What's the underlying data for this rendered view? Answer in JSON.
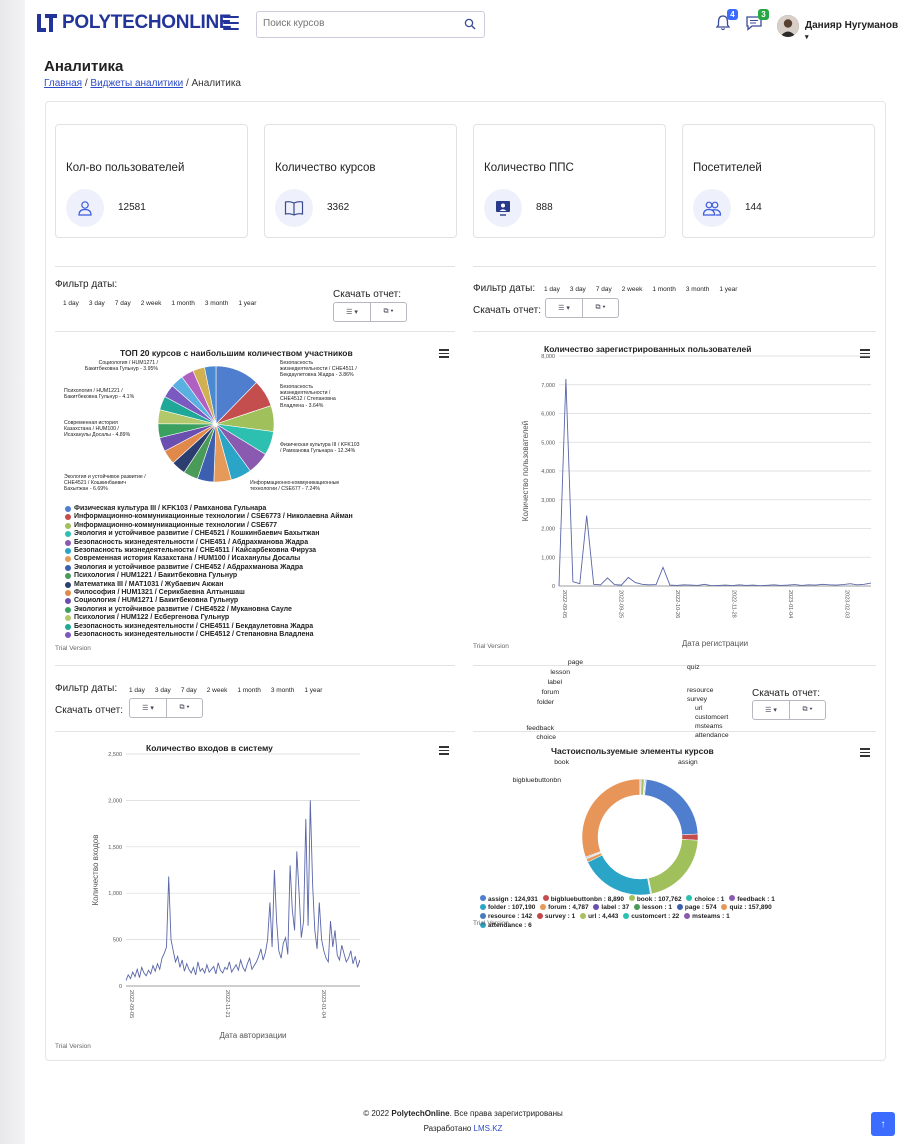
{
  "header": {
    "logo_text": "POLYTECHONLINE",
    "search_placeholder": "Поиск курсов",
    "notifications_count": "4",
    "messages_count": "3",
    "user_name": "Данияр Нугуманов",
    "user_caret": "▾",
    "brand_color": "#22349a"
  },
  "page": {
    "title": "Аналитика",
    "breadcrumb": [
      {
        "label": "Главная"
      },
      {
        "label": "Виджеты аналитики"
      },
      {
        "label": "Аналитика"
      }
    ],
    "breadcrumb_sep": "/"
  },
  "stats": [
    {
      "title": "Кол-во пользователей",
      "value": "12581",
      "icon": "user-icon"
    },
    {
      "title": "Количество курсов",
      "value": "3362",
      "icon": "book-icon"
    },
    {
      "title": "Количество ППС",
      "value": "888",
      "icon": "teacher-icon"
    },
    {
      "title": "Посетителей",
      "value": "144",
      "icon": "users-icon"
    }
  ],
  "filters": {
    "label": "Фильтр даты:",
    "options": [
      "1 day",
      "3 day",
      "7 day",
      "2 week",
      "1 month",
      "3 month",
      "1 year"
    ],
    "download_label": "Скачать отчет:",
    "list_btn": "☰ ▾",
    "export_btn": "⧉ ▾"
  },
  "trial_text": "Trial Version",
  "pie_chart": {
    "chart_data": {
      "type": "pie",
      "title": "ТОП 20 курсов с наибольшим количеством участников",
      "slices": [
        {
          "name": "Физическая культура III / KFK103 / Рамханова Гульнара",
          "value": 12.34,
          "color": "#4f7ecf"
        },
        {
          "name": "Информационно-коммуникационные технологии / CSE6773 / Николаевна Айман",
          "value": 7.6,
          "color": "#c44d4d"
        },
        {
          "name": "Информационно-коммуникационные технологии / CSE677",
          "value": 7.24,
          "color": "#9fc05a"
        },
        {
          "name": "Экология и устойчивое развитие / CHE4521 / Кошкинбаевич Бахытжан",
          "value": 6.69,
          "color": "#2dbfb0"
        },
        {
          "name": "Безопасность жизнедеятельности / CHE451 / Абдрахманова Жадра",
          "value": 6.2,
          "color": "#8a5ab0"
        },
        {
          "name": "Безопасность жизнедеятельности / CHE4511 / Кайсарбековна Фируза",
          "value": 5.8,
          "color": "#2aa5c8"
        },
        {
          "name": "Современная история Казахстана / HUM100 / Исаханулы Досалы",
          "value": 4.89,
          "color": "#e69a5a"
        },
        {
          "name": "Экология и устойчивое развитие / CHE452 / Абдрахманова Жадра",
          "value": 4.6,
          "color": "#3d5fb0"
        },
        {
          "name": "Психология / HUM1221 / Бакитбековна Гульнур",
          "value": 4.1,
          "color": "#4a9a5a"
        },
        {
          "name": "Математика III / MAT1031 / Жубаевич Акжан",
          "value": 4.0,
          "color": "#2c3e70"
        },
        {
          "name": "Философия / HUM1321 / Серикбаевна Алтыншаш",
          "value": 4.0,
          "color": "#e0894a"
        },
        {
          "name": "Социология / HUM1271 / Бакитбековна Гульнур",
          "value": 3.95,
          "color": "#6b4fb0"
        },
        {
          "name": "Экология и устойчивое развитие / CHE4522 / Мукановна Сауле",
          "value": 3.9,
          "color": "#3aa060"
        },
        {
          "name": "Психология / HUM122 / Есбергенова Гульнур",
          "value": 3.9,
          "color": "#b2c86a"
        },
        {
          "name": "Безопасность жизнедеятельности / CHE4511 / Бекдаулетовна Жадра",
          "value": 3.86,
          "color": "#1fa898"
        },
        {
          "name": "Безопасность жизнедеятельности / CHE4512 / Степановна Владлена",
          "value": 3.64,
          "color": "#7a5ac0"
        },
        {
          "name": "",
          "value": 3.6,
          "color": "#5ab0e0"
        },
        {
          "name": "",
          "value": 3.5,
          "color": "#b060c0"
        },
        {
          "name": "",
          "value": 3.3,
          "color": "#d0b050"
        },
        {
          "name": "",
          "value": 3.2,
          "color": "#4a8ad0"
        }
      ]
    },
    "labels": {
      "l1": "Социология / HUM1271 / Бакитбековна Гульнур - 3.95%",
      "l2": "Психология / HUM1221 / Бакитбековна Гульнур - 4.1%",
      "l3": "Современная история Казахстана / HUM100 / Исаханулы Досалы - 4.89%",
      "l4": "Экология и устойчивое развитие / CHE4521 / Кошкинбаевич Бахытжан - 6.69%",
      "r1": "Безопасность жизнедеятельности / CHE4511 / Бекдаулетовна Жадра - 3.86%",
      "r2": "Безопасность жизнедеятельности / CHE4512 / Степановна Владлена - 3.64%",
      "r3": "Физическая культура III / KFK103 / Рамханова Гульнара - 12.34%",
      "r4": "Информационно-коммуникационные технологии / CSE677 - 7.24%"
    }
  },
  "reg_chart": {
    "chart_data": {
      "type": "line",
      "title": "Количество зарегистрированных пользователей",
      "xlabel": "Дата регистрации",
      "ylabel": "Количество пользователей",
      "ylim": [
        0,
        8000
      ],
      "yticks": [
        "0",
        "1,000",
        "2,000",
        "3,000",
        "4,000",
        "5,000",
        "6,000",
        "7,000",
        "8,000"
      ],
      "xticks": [
        "2022-09-05",
        "2022-09-25",
        "2022-10-26",
        "2022-11-28",
        "2023-01-04",
        "2023-02-03"
      ],
      "values": [
        0,
        7200,
        150,
        80,
        2450,
        60,
        40,
        280,
        50,
        30,
        300,
        120,
        60,
        40,
        50,
        650,
        30,
        20,
        40,
        30,
        20,
        60,
        10,
        20,
        30,
        15,
        40,
        20,
        30,
        10,
        25,
        40,
        20,
        30,
        50,
        20,
        40,
        30,
        60,
        40,
        30,
        50,
        80,
        40,
        60,
        100
      ]
    }
  },
  "login_chart": {
    "chart_data": {
      "type": "line",
      "title": "Количество входов в систему",
      "xlabel": "Дата авторизации",
      "ylabel": "Количество входов",
      "ylim": [
        0,
        2500
      ],
      "yticks": [
        "0",
        "500",
        "1,000",
        "1,500",
        "2,000",
        "2,500"
      ],
      "xticks": [
        "2022-09-05",
        "2022-11-21",
        "2023-01-04"
      ],
      "values": [
        60,
        120,
        80,
        150,
        100,
        180,
        90,
        200,
        140,
        110,
        170,
        130,
        220,
        160,
        240,
        180,
        300,
        350,
        420,
        1180,
        500,
        380,
        260,
        320,
        200,
        280,
        160,
        240,
        180,
        140,
        200,
        120,
        260,
        160,
        190,
        140,
        230,
        150,
        180,
        210,
        130,
        250,
        170,
        140,
        200,
        180,
        260,
        150,
        190,
        230,
        170,
        280,
        200,
        160,
        240,
        300,
        180,
        220,
        260,
        320,
        400,
        280,
        360,
        500,
        900,
        420,
        1250,
        700,
        380,
        300,
        460,
        520,
        340,
        1300,
        820,
        600,
        1450,
        1000,
        520,
        700,
        1800,
        650,
        2000,
        1100,
        600,
        400,
        900,
        500,
        380,
        300,
        260,
        700,
        420,
        600,
        330,
        280,
        440,
        350,
        260,
        300,
        380,
        240,
        320,
        200,
        280,
        160,
        220,
        300,
        180,
        260,
        140,
        200,
        120,
        160
      ]
    }
  },
  "donut_chart": {
    "chart_data": {
      "type": "pie",
      "title": "Частоиспользуемые элементы курсов",
      "slices": [
        {
          "name": "assign",
          "value": 124931,
          "color": "#4f7ecf"
        },
        {
          "name": "bigbluebuttonbn",
          "value": 8890,
          "color": "#c44d4d"
        },
        {
          "name": "book",
          "value": 107762,
          "color": "#9fc05a"
        },
        {
          "name": "choice",
          "value": 1,
          "color": "#2dbfb0"
        },
        {
          "name": "feedback",
          "value": 1,
          "color": "#8a5ab0"
        },
        {
          "name": "folder",
          "value": 107190,
          "color": "#2aa5c8"
        },
        {
          "name": "forum",
          "value": 4787,
          "color": "#e69a5a"
        },
        {
          "name": "label",
          "value": 37,
          "color": "#6b4fb0"
        },
        {
          "name": "lesson",
          "value": 1,
          "color": "#4a9a5a"
        },
        {
          "name": "page",
          "value": 574,
          "color": "#3d5fb0"
        },
        {
          "name": "quiz",
          "value": 157890,
          "color": "#e8955a"
        },
        {
          "name": "resource",
          "value": 142,
          "color": "#4a7ac0"
        },
        {
          "name": "survey",
          "value": 1,
          "color": "#c04a4a"
        },
        {
          "name": "url",
          "value": 4443,
          "color": "#a8c060"
        },
        {
          "name": "customcert",
          "value": 22,
          "color": "#2dbfb0"
        },
        {
          "name": "msteams",
          "value": 1,
          "color": "#8a5ab0"
        },
        {
          "name": "attendance",
          "value": 6,
          "color": "#2aa5c8"
        }
      ]
    },
    "legend": [
      "assign : 124,931",
      "bigbluebuttonbn : 8,890",
      "book : 107,762",
      "choice : 1",
      "feedback : 1",
      "folder : 107,190",
      "forum : 4,787",
      "label : 37",
      "lesson : 1",
      "page : 574",
      "quiz : 157,890",
      "resource : 142",
      "survey : 1",
      "url : 4,443",
      "customcert : 22",
      "msteams : 1",
      "attendance : 6"
    ]
  },
  "footer": {
    "copyright_prefix": "© 2022 ",
    "brand": "PolytechOnline",
    "copyright_suffix": ". Все права зарегистрированы",
    "dev_prefix": "Разработано ",
    "dev_link": "LMS.KZ",
    "totop": "↑"
  }
}
